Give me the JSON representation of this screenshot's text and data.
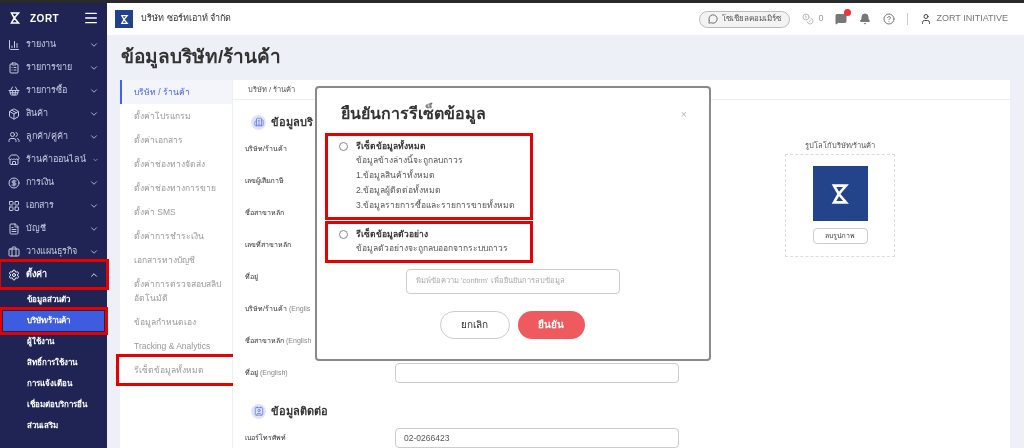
{
  "sidebar": {
    "brand": "ZORT",
    "items": [
      {
        "label": "รายงาน",
        "expanded": false,
        "highlighted": false
      },
      {
        "label": "รายการขาย",
        "expanded": false,
        "highlighted": false
      },
      {
        "label": "รายการซื้อ",
        "expanded": false,
        "highlighted": false
      },
      {
        "label": "สินค้า",
        "expanded": false,
        "highlighted": false
      },
      {
        "label": "ลูกค้า/คู่ค้า",
        "expanded": false,
        "highlighted": false
      },
      {
        "label": "ร้านค้าออนไลน์",
        "expanded": false,
        "highlighted": false
      },
      {
        "label": "การเงิน",
        "expanded": false,
        "highlighted": false
      },
      {
        "label": "เอกสาร",
        "expanded": false,
        "highlighted": false
      },
      {
        "label": "บัญชี",
        "expanded": false,
        "highlighted": false
      },
      {
        "label": "วางแผนธุรกิจ",
        "expanded": false,
        "highlighted": false
      },
      {
        "label": "ตั้งค่า",
        "expanded": true,
        "highlighted": true,
        "children": [
          {
            "label": "ข้อมูลส่วนตัว",
            "selected": false,
            "highlighted": false
          },
          {
            "label": "บริษัท/ร้านค้า",
            "selected": true,
            "highlighted": true
          },
          {
            "label": "ผู้ใช้งาน",
            "selected": false,
            "highlighted": false
          },
          {
            "label": "สิทธิ์การใช้งาน",
            "selected": false,
            "highlighted": false
          },
          {
            "label": "การแจ้งเตือน",
            "selected": false,
            "highlighted": false
          },
          {
            "label": "เชื่อมต่อบริการอื่น",
            "selected": false,
            "highlighted": false
          },
          {
            "label": "ส่วนเสริม",
            "selected": false,
            "highlighted": false
          }
        ]
      }
    ]
  },
  "header": {
    "company": "บริษัท ซอร์ทเอาท์ จำกัด",
    "social_button": "โซเชียลคอมเมิร์ซ",
    "coin_count": "0",
    "user": "ZORT INITIATIVE"
  },
  "page_title": "ข้อมูลบริษัท/ร้านค้า",
  "settings_nav": [
    {
      "label": "บริษัท / ร้านค้า",
      "selected": true,
      "highlighted": false
    },
    {
      "label": "ตั้งค่าโปรแกรม",
      "selected": false,
      "highlighted": false
    },
    {
      "label": "ตั้งค่าเอกสาร",
      "selected": false,
      "highlighted": false
    },
    {
      "label": "ตั้งค่าช่องทางจัดส่ง",
      "selected": false,
      "highlighted": false
    },
    {
      "label": "ตั้งค่าช่องทางการขาย",
      "selected": false,
      "highlighted": false
    },
    {
      "label": "ตั้งค่า SMS",
      "selected": false,
      "highlighted": false
    },
    {
      "label": "ตั้งค่าการชำระเงิน",
      "selected": false,
      "highlighted": false
    },
    {
      "label": "เอกสารทางบัญชี",
      "selected": false,
      "highlighted": false
    },
    {
      "label": "ตั้งค่าการตรวจสอบสลิปอัตโนมัติ",
      "selected": false,
      "highlighted": false
    },
    {
      "label": "ข้อมูลกำหนดเอง",
      "selected": false,
      "highlighted": false
    },
    {
      "label": "Tracking & Analytics",
      "selected": false,
      "highlighted": false
    },
    {
      "label": "รีเซ็ตข้อมูลทั้งหมด",
      "selected": false,
      "highlighted": true
    }
  ],
  "content": {
    "breadcrumb": "บริษัท / ร้านค้า",
    "sections": [
      {
        "title": "ข้อมูลบริ",
        "rows": [
          {
            "label": "บริษัท/ร้านค้า"
          },
          {
            "label": "เลขผู้เสียภาษี"
          },
          {
            "label": "ชื่อสาขาหลัก"
          },
          {
            "label": "เลขที่สาขาหลัก"
          },
          {
            "label": "ที่อยู่"
          },
          {
            "label": "บริษัท/ร้านค้า",
            "suffix": "(Englis"
          },
          {
            "label": "ชื่อสาขาหลัก",
            "suffix": "(English"
          },
          {
            "label": "ที่อยู่",
            "suffix": "(English)",
            "field": {
              "kind": "textarea"
            }
          }
        ]
      },
      {
        "title": "ข้อมูลติดต่อ",
        "rows": [
          {
            "label": "เบอร์โทรศัพท์",
            "field": {
              "kind": "input",
              "value": "02-0266423"
            }
          }
        ]
      }
    ],
    "logo": {
      "label": "รูปโลโก้บริษัท/ร้านค้า",
      "button": "ลบรูปภาพ"
    }
  },
  "modal": {
    "title": "ยืนยันการรีเซ็ตข้อมูล",
    "close": "×",
    "options": [
      {
        "label": "รีเซ็ตข้อมูลทั้งหมด",
        "selected": false,
        "highlighted": true,
        "lines": [
          "ข้อมูลข้างล่างนี้จะถูกลบถาวร",
          "1.ข้อมูลสินค้าทั้งหมด",
          "2.ข้อมูลผู้ติดต่อทั้งหมด",
          "3.ข้อมูลรายการซื้อและรายการขายทั้งหมด"
        ]
      },
      {
        "label": "รีเซ็ตข้อมูลตัวอย่าง",
        "selected": false,
        "highlighted": true,
        "lines": [
          "ข้อมูลตัวอย่างจะถูกลบออกจากระบบถาวร"
        ]
      }
    ],
    "input": {
      "placeholder": "พิมพ์ข้อความ 'confirm' เพื่อยืนยันการลบข้อมูล"
    },
    "buttons": [
      {
        "label": "ยกเลิก",
        "kind": "secondary"
      },
      {
        "label": "ยืนยัน",
        "kind": "primary"
      }
    ]
  }
}
